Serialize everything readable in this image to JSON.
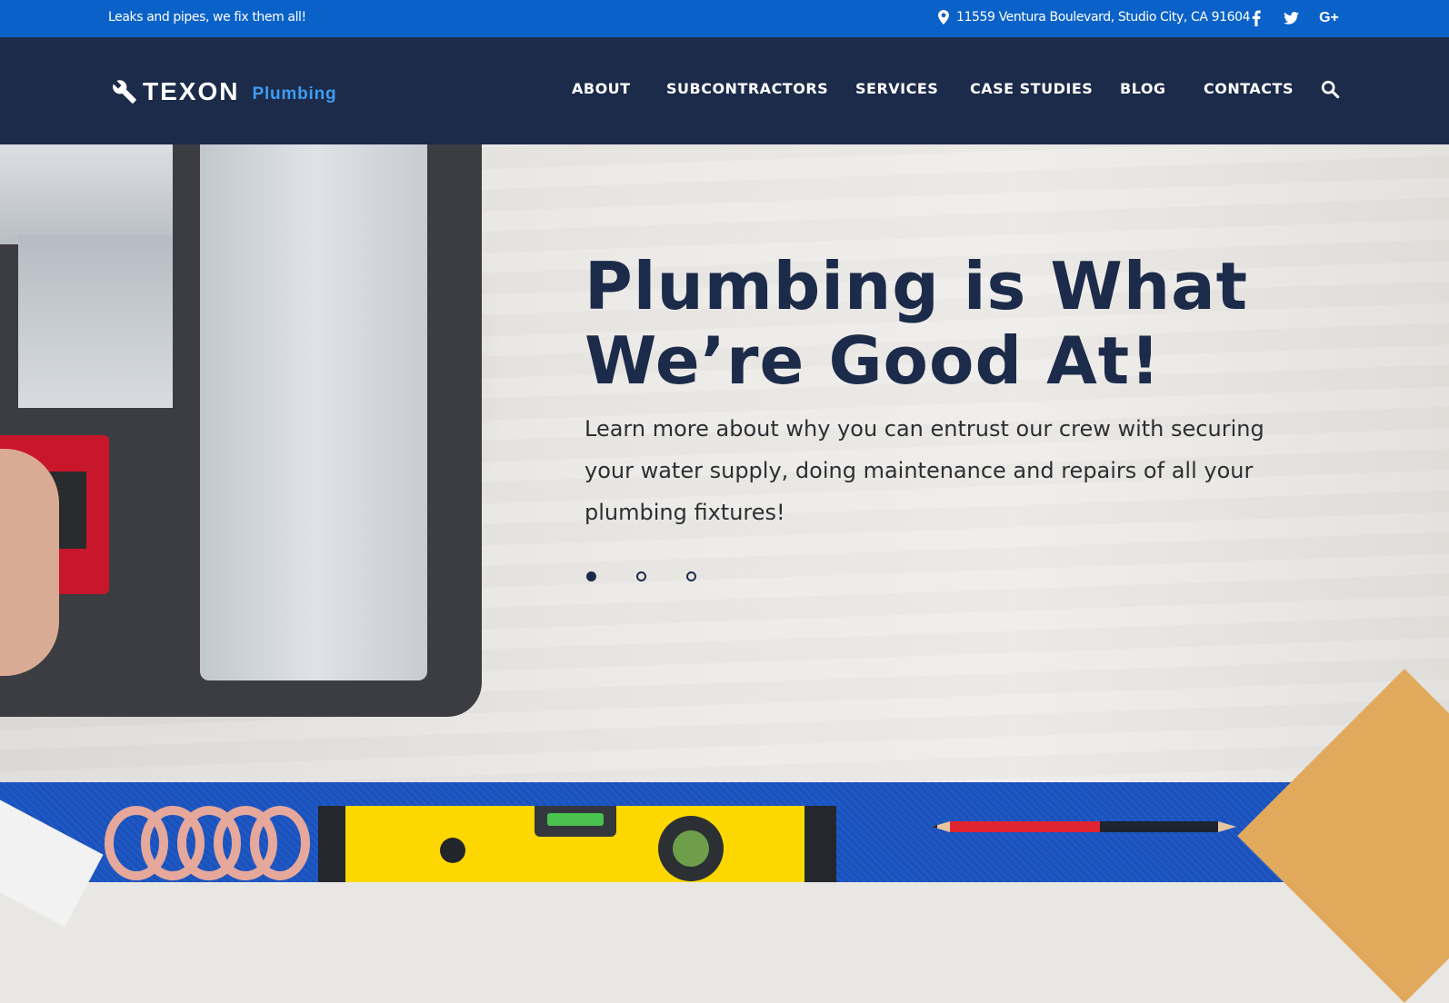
{
  "topbar": {
    "tagline": "Leaks and pipes, we fix them all!",
    "address": "11559 Ventura Boulevard, Studio City, CA 91604",
    "social": [
      "f",
      "twitter-bird",
      "G+"
    ]
  },
  "brand": {
    "name": "TEXON",
    "sub": "Plumbing",
    "accent_color": "#3f9cf2"
  },
  "nav": {
    "items": [
      "ABOUT",
      "SUBCONTRACTORS",
      "SERVICES",
      "CASE STUDIES",
      "BLOG",
      "CONTACTS"
    ]
  },
  "hero": {
    "title": "Plumbing is What We’re Good At!",
    "text": "Learn more about why you can entrust our crew with securing your water supply, doing maintenance and repairs of all your plumbing fixtures!",
    "slides": 3,
    "active_slide": 1
  },
  "colors": {
    "topbar": "#0a62c8",
    "navbar": "#1c2b4a",
    "heading": "#1c2b4a"
  }
}
